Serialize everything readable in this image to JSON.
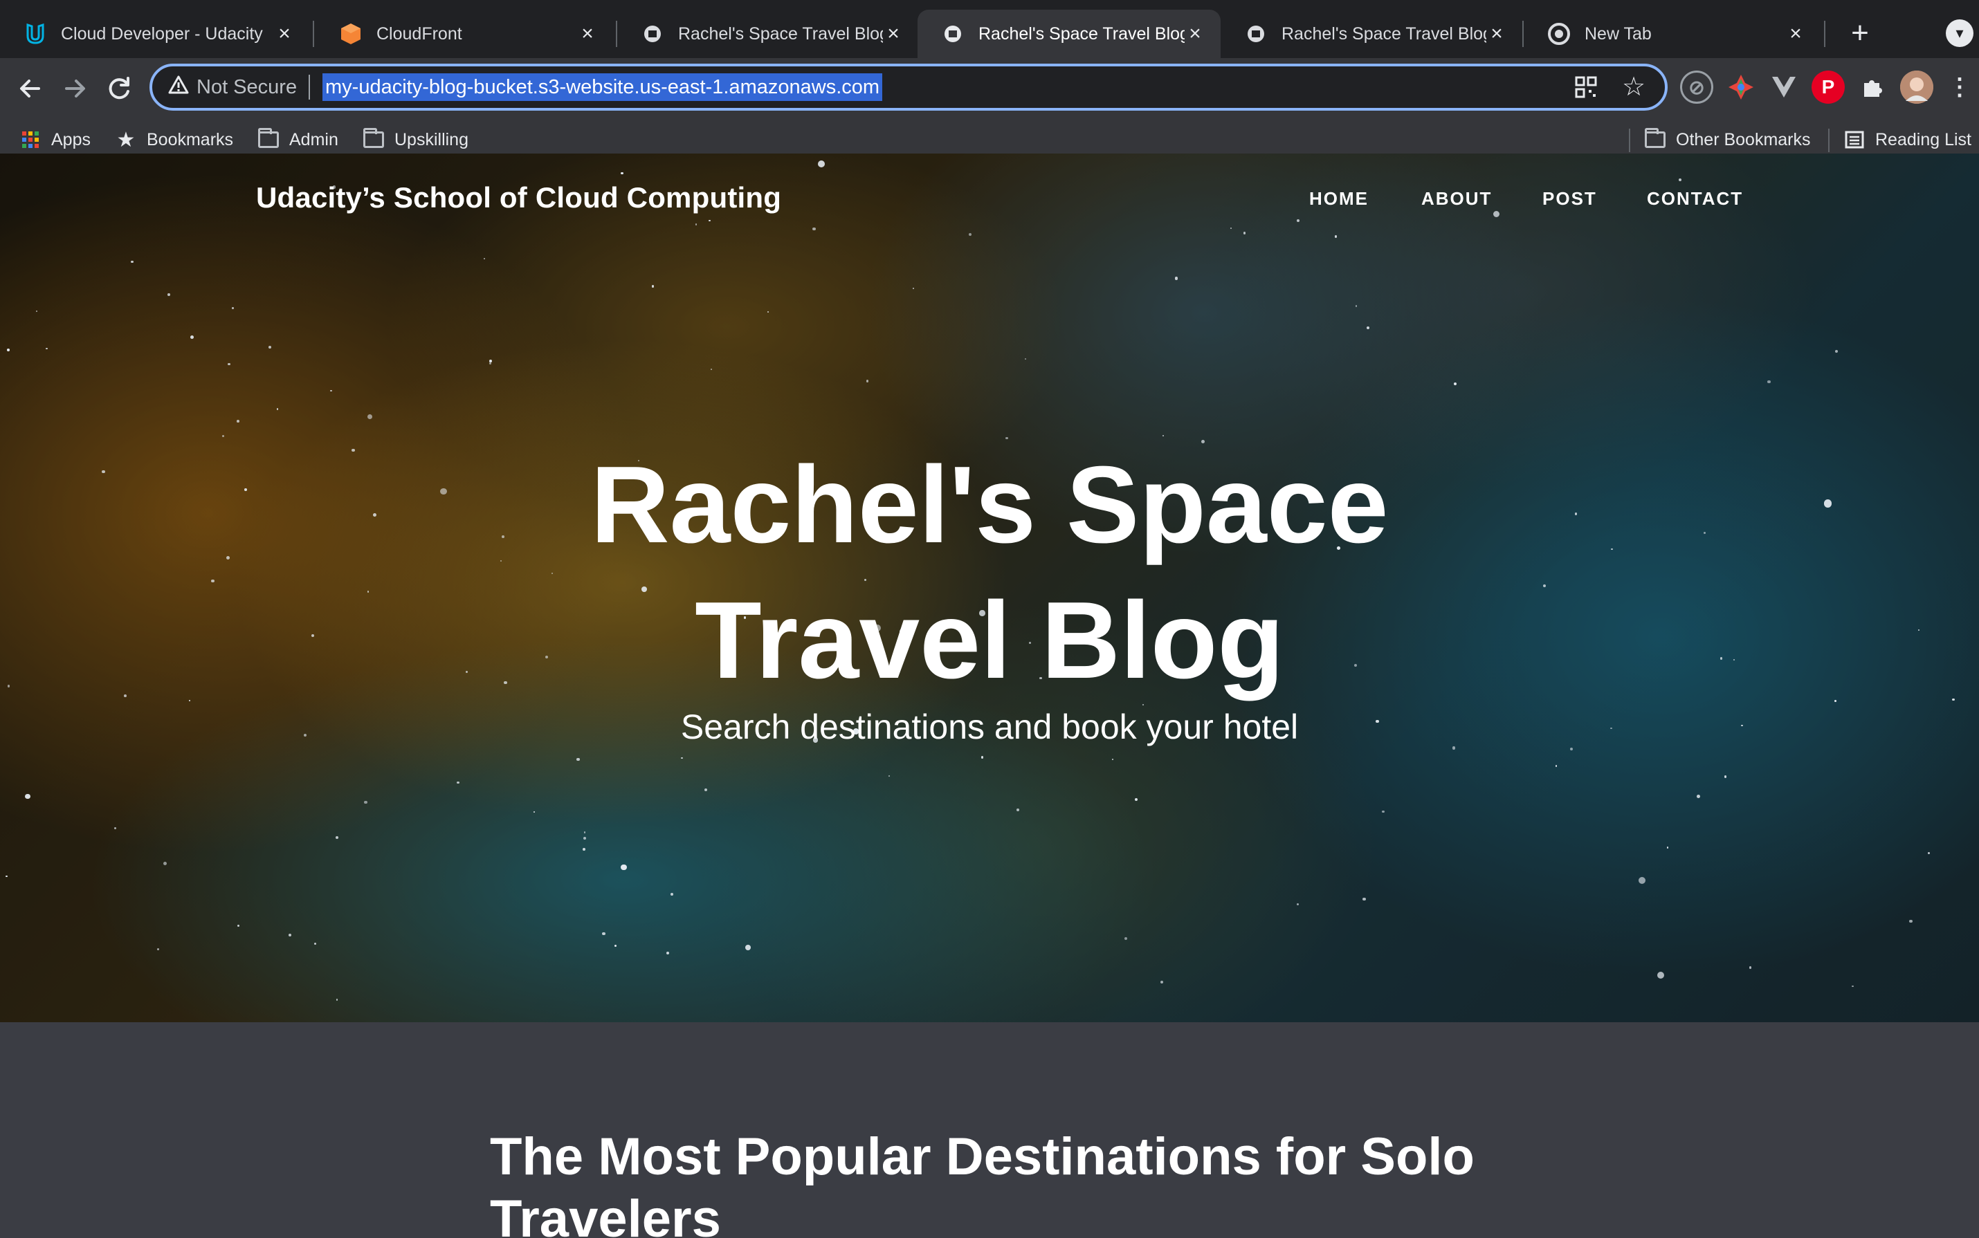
{
  "browser": {
    "tabs": [
      {
        "title": "Cloud Developer - Udacity",
        "favicon": "udacity-icon",
        "active": false
      },
      {
        "title": "CloudFront",
        "favicon": "aws-cube-icon",
        "active": false
      },
      {
        "title": "Rachel's Space Travel Blog",
        "favicon": "blog-icon",
        "active": false
      },
      {
        "title": "Rachel's Space Travel Blog",
        "favicon": "blog-icon",
        "active": true
      },
      {
        "title": "Rachel's Space Travel Blog",
        "favicon": "blog-icon",
        "active": false
      },
      {
        "title": "New Tab",
        "favicon": "chrome-icon",
        "active": false
      }
    ],
    "close_glyph": "×",
    "new_tab_glyph": "+",
    "address": {
      "security_label": "Not Secure",
      "url": "my-udacity-blog-bucket.s3-website.us-east-1.amazonaws.com"
    },
    "bookmarks": {
      "apps": "Apps",
      "bookmarks": "Bookmarks",
      "admin": "Admin",
      "upskilling": "Upskilling",
      "other": "Other Bookmarks",
      "reading_list": "Reading List"
    }
  },
  "site": {
    "brand": "Udacity’s School of Cloud Computing",
    "nav": [
      "HOME",
      "ABOUT",
      "POST",
      "CONTACT"
    ],
    "hero_title_line1": "Rachel's Space",
    "hero_title_line2": "Travel Blog",
    "hero_subtitle": "Search destinations and book your hotel",
    "post_heading": "The Most Popular Destinations for Solo Travelers"
  },
  "colors": {
    "tabstrip": "#202124",
    "toolbar": "#35363a",
    "omnibox_focus": "#8ab4f8",
    "url_selection": "#3367d6",
    "page_section": "#3b3d44"
  }
}
